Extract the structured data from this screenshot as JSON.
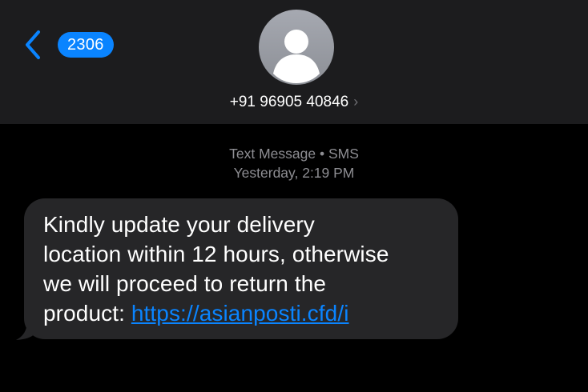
{
  "header": {
    "back_icon": "chevron-left-icon",
    "unread_count": "2306",
    "avatar_icon": "person-icon",
    "contact_number": "+91 96905 40846",
    "contact_chevron": "›",
    "colors": {
      "header_bg": "#1c1c1e",
      "accent": "#0a84ff"
    }
  },
  "thread": {
    "service_label": "Text Message • SMS",
    "timestamp": "Yesterday, 2:19 PM"
  },
  "message": {
    "text_line_1": "Kindly update your delivery",
    "text_line_2": "location within 12 hours, otherwise",
    "text_line_3": "we will proceed to return the",
    "text_line_4_prefix": "product: ",
    "link": "https://asianposti.cfd/i",
    "bubble_color": "#262628",
    "link_color": "#0a84ff"
  }
}
